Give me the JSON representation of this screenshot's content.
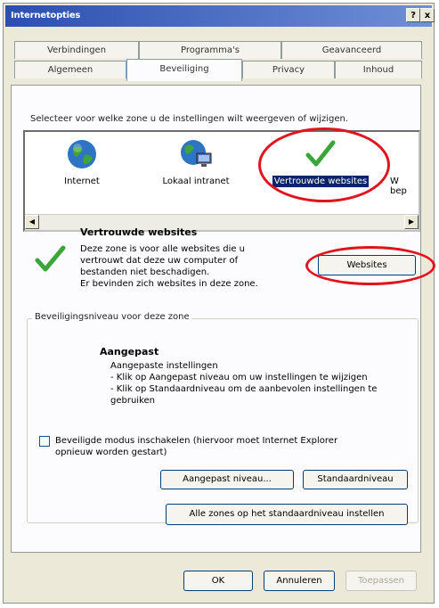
{
  "window": {
    "title": "Internetopties",
    "help": "?",
    "close": "x"
  },
  "tabs_row1": [
    "Verbindingen",
    "Programma's",
    "Geavanceerd"
  ],
  "tabs_row2": [
    "Algemeen",
    "Beveiliging",
    "Privacy",
    "Inhoud"
  ],
  "instruction": "Selecteer voor welke zone u de instellingen wilt weergeven of wijzigen.",
  "zones": [
    {
      "label": "Internet",
      "icon": "globe-icon"
    },
    {
      "label": "Lokaal intranet",
      "icon": "intranet-icon"
    },
    {
      "label": "Vertrouwde websites",
      "icon": "checkmark-icon",
      "selected": true
    },
    {
      "label": "W bep",
      "icon": "partial-zone"
    }
  ],
  "zone_info": {
    "title": "Vertrouwde websites",
    "line1": "Deze zone is voor alle websites die u",
    "line2": "vertrouwt dat deze uw computer of",
    "line3": "bestanden niet beschadigen.",
    "line4": "Er bevinden zich websites in deze zone.",
    "websites_button": "Websites"
  },
  "security_level": {
    "legend": "Beveiligingsniveau voor deze zone",
    "name": "Aangepast",
    "desc1": "Aangepaste instellingen",
    "desc2": "- Klik op Aangepast niveau om uw instellingen te wijzigen",
    "desc3": "- Klik op Standaardniveau om de aanbevolen instellingen te",
    "desc4": "gebruiken"
  },
  "protected_mode": {
    "line1": "Beveiligde modus inschakelen (hiervoor moet Internet Explorer",
    "line2": "opnieuw worden gestart)",
    "checked": false
  },
  "buttons": {
    "custom_level": "Aangepast niveau...",
    "default_level": "Standaardniveau",
    "reset_all": "Alle zones op het standaardniveau instellen",
    "ok": "OK",
    "cancel": "Annuleren",
    "apply": "Toepassen"
  },
  "colors": {
    "highlight": "#e0141c",
    "selection": "#0a246a",
    "titlebar": "#2b4fb0"
  }
}
